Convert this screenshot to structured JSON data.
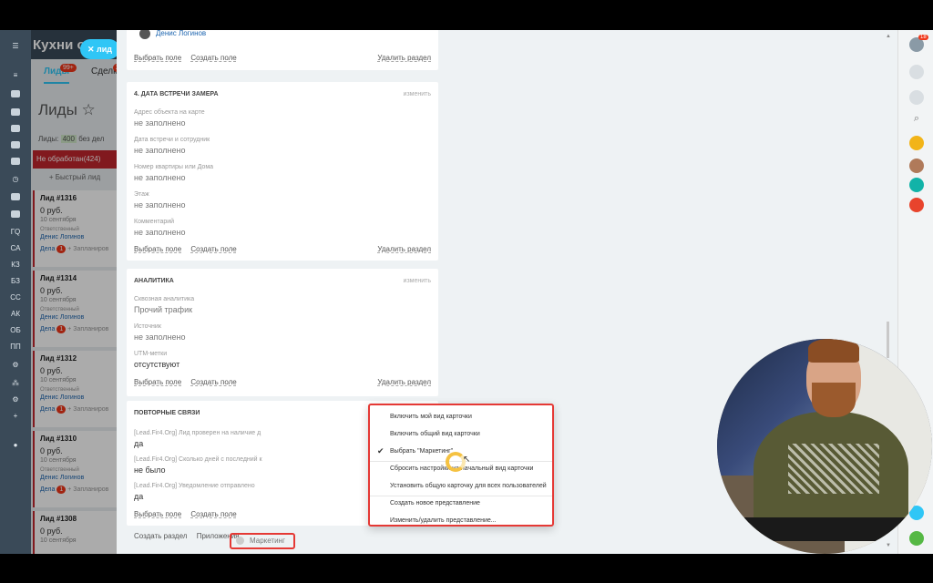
{
  "crm": {
    "title": "Кухни он",
    "search_chip": "лид",
    "tabs": [
      {
        "label": "Лиды",
        "badge": "99+"
      },
      {
        "label": "Сделки",
        "badge": "2"
      }
    ],
    "page_title": "Лиды",
    "stats_label": "Лиды:",
    "stats_count": "400",
    "stats_no_deals": "без дел",
    "stage": {
      "name": "Не обработан",
      "count": "(424)"
    },
    "quick_lead": "+ Быстрый лид",
    "leads": [
      {
        "title": "Лид #1316",
        "price": "0 руб.",
        "date": "10 сентября",
        "resp_label": "Ответственный",
        "person": "Денис Логинов",
        "deals": "Дела",
        "deals_count": "1",
        "plan": "+ Запланиров"
      },
      {
        "title": "Лид #1314",
        "price": "0 руб.",
        "date": "10 сентября",
        "resp_label": "Ответственный",
        "person": "Денис Логинов",
        "deals": "Дела",
        "deals_count": "1",
        "plan": "+ Запланиров"
      },
      {
        "title": "Лид #1312",
        "price": "0 руб.",
        "date": "10 сентября",
        "resp_label": "Ответственный",
        "person": "Денис Логинов",
        "deals": "Дела",
        "deals_count": "1",
        "plan": "+ Запланиров"
      },
      {
        "title": "Лид #1310",
        "price": "0 руб.",
        "date": "10 сентября",
        "resp_label": "Ответственный",
        "person": "Денис Логинов",
        "deals": "Дела",
        "deals_count": "1",
        "plan": "+ Запланиров"
      },
      {
        "title": "Лид #1308",
        "price": "0 руб.",
        "date": "10 сентября"
      }
    ]
  },
  "left_rail": [
    "ГQ",
    "СА",
    "КЗ",
    "БЗ",
    "СС",
    "АК",
    "ОБ",
    "ПП"
  ],
  "card": {
    "top_person": "Денис Логинов",
    "common_footer": {
      "choose": "Выбрать поле",
      "create": "Создать поле",
      "delete": "Удалить раздел"
    },
    "sections": [
      {
        "title": "4. Дата встречи замера",
        "edit": "изменить",
        "fields": [
          {
            "label": "Адрес объекта на карте",
            "value": "не заполнено"
          },
          {
            "label": "Дата встречи и сотрудник",
            "value": "не заполнено"
          },
          {
            "label": "Номер квартиры или Дома",
            "value": "не заполнено"
          },
          {
            "label": "Этаж",
            "value": "не заполнено"
          },
          {
            "label": "Комментарий",
            "value": "не заполнено"
          }
        ]
      },
      {
        "title": "Аналитика",
        "edit": "изменить",
        "fields": [
          {
            "label": "Сквозная аналитика",
            "value": "Прочий трафик"
          },
          {
            "label": "Источник",
            "value": "не заполнено"
          },
          {
            "label": "UTM-метки",
            "value": "отсутствуют"
          }
        ]
      },
      {
        "title": "Повторные связи",
        "fields": [
          {
            "label": "[Lead.Fir4.Org] Лид проверен на наличие д",
            "value": "да"
          },
          {
            "label": "[Lead.Fir4.Org] Сколько дней с последний к",
            "value": "не было"
          },
          {
            "label": "[Lead.Fir4.Org] Уведомление отправлено",
            "value": "да"
          }
        ]
      }
    ],
    "bottom": {
      "create_section": "Создать раздел",
      "apps": "Приложения",
      "view": "Маркетинг"
    }
  },
  "menu": {
    "items": [
      {
        "label": "Включить мой вид карточки",
        "checked": false
      },
      {
        "label": "Включить общий вид карточки",
        "checked": false
      },
      {
        "label": "Выбрать \"Маркетинг\"",
        "checked": true
      },
      {
        "label": "Сбросить настройки на начальный вид карточки",
        "checked": false
      },
      {
        "label": "Установить общую карточку для всех пользователей",
        "checked": false
      },
      {
        "label": "Создать новое представление",
        "checked": false
      },
      {
        "label": "Изменить/удалить представление...",
        "checked": false
      }
    ]
  },
  "right_rail": {
    "notify_badge": "18"
  },
  "colors": {
    "accent": "#2fc6f6",
    "stage_red": "#c0262d",
    "highlight_red": "#e53935",
    "rail_dark": "#3a4a58"
  }
}
